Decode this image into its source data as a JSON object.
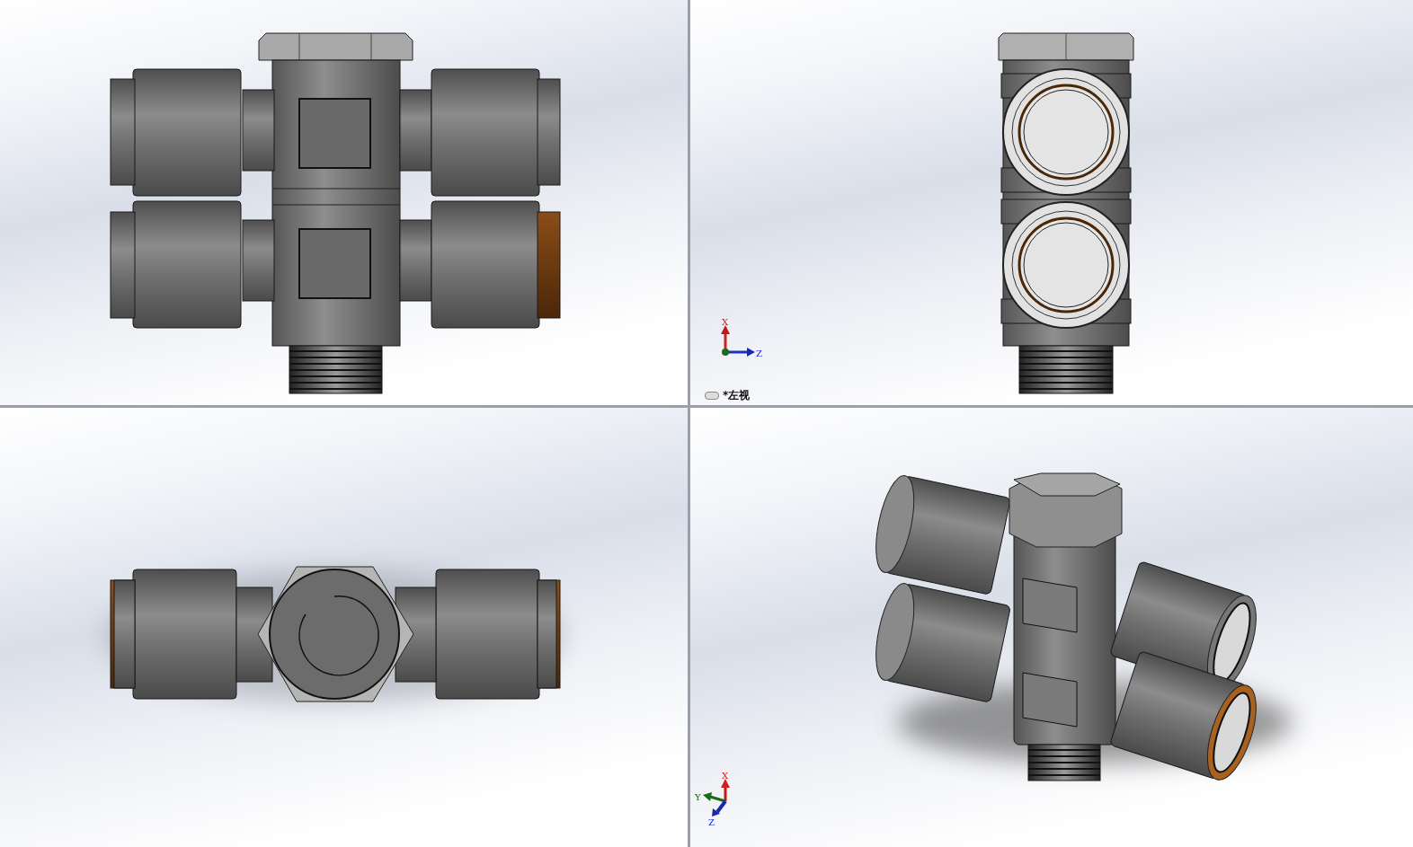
{
  "viewports": [
    {
      "kind": "front"
    },
    {
      "kind": "left",
      "label": "*左视",
      "linked": true,
      "triad": {
        "kind": "planar",
        "labels": [
          "X",
          "Z"
        ]
      }
    },
    {
      "kind": "top"
    },
    {
      "kind": "iso",
      "triad": {
        "kind": "spatial",
        "labels": [
          "X",
          "Y",
          "Z"
        ]
      }
    }
  ]
}
